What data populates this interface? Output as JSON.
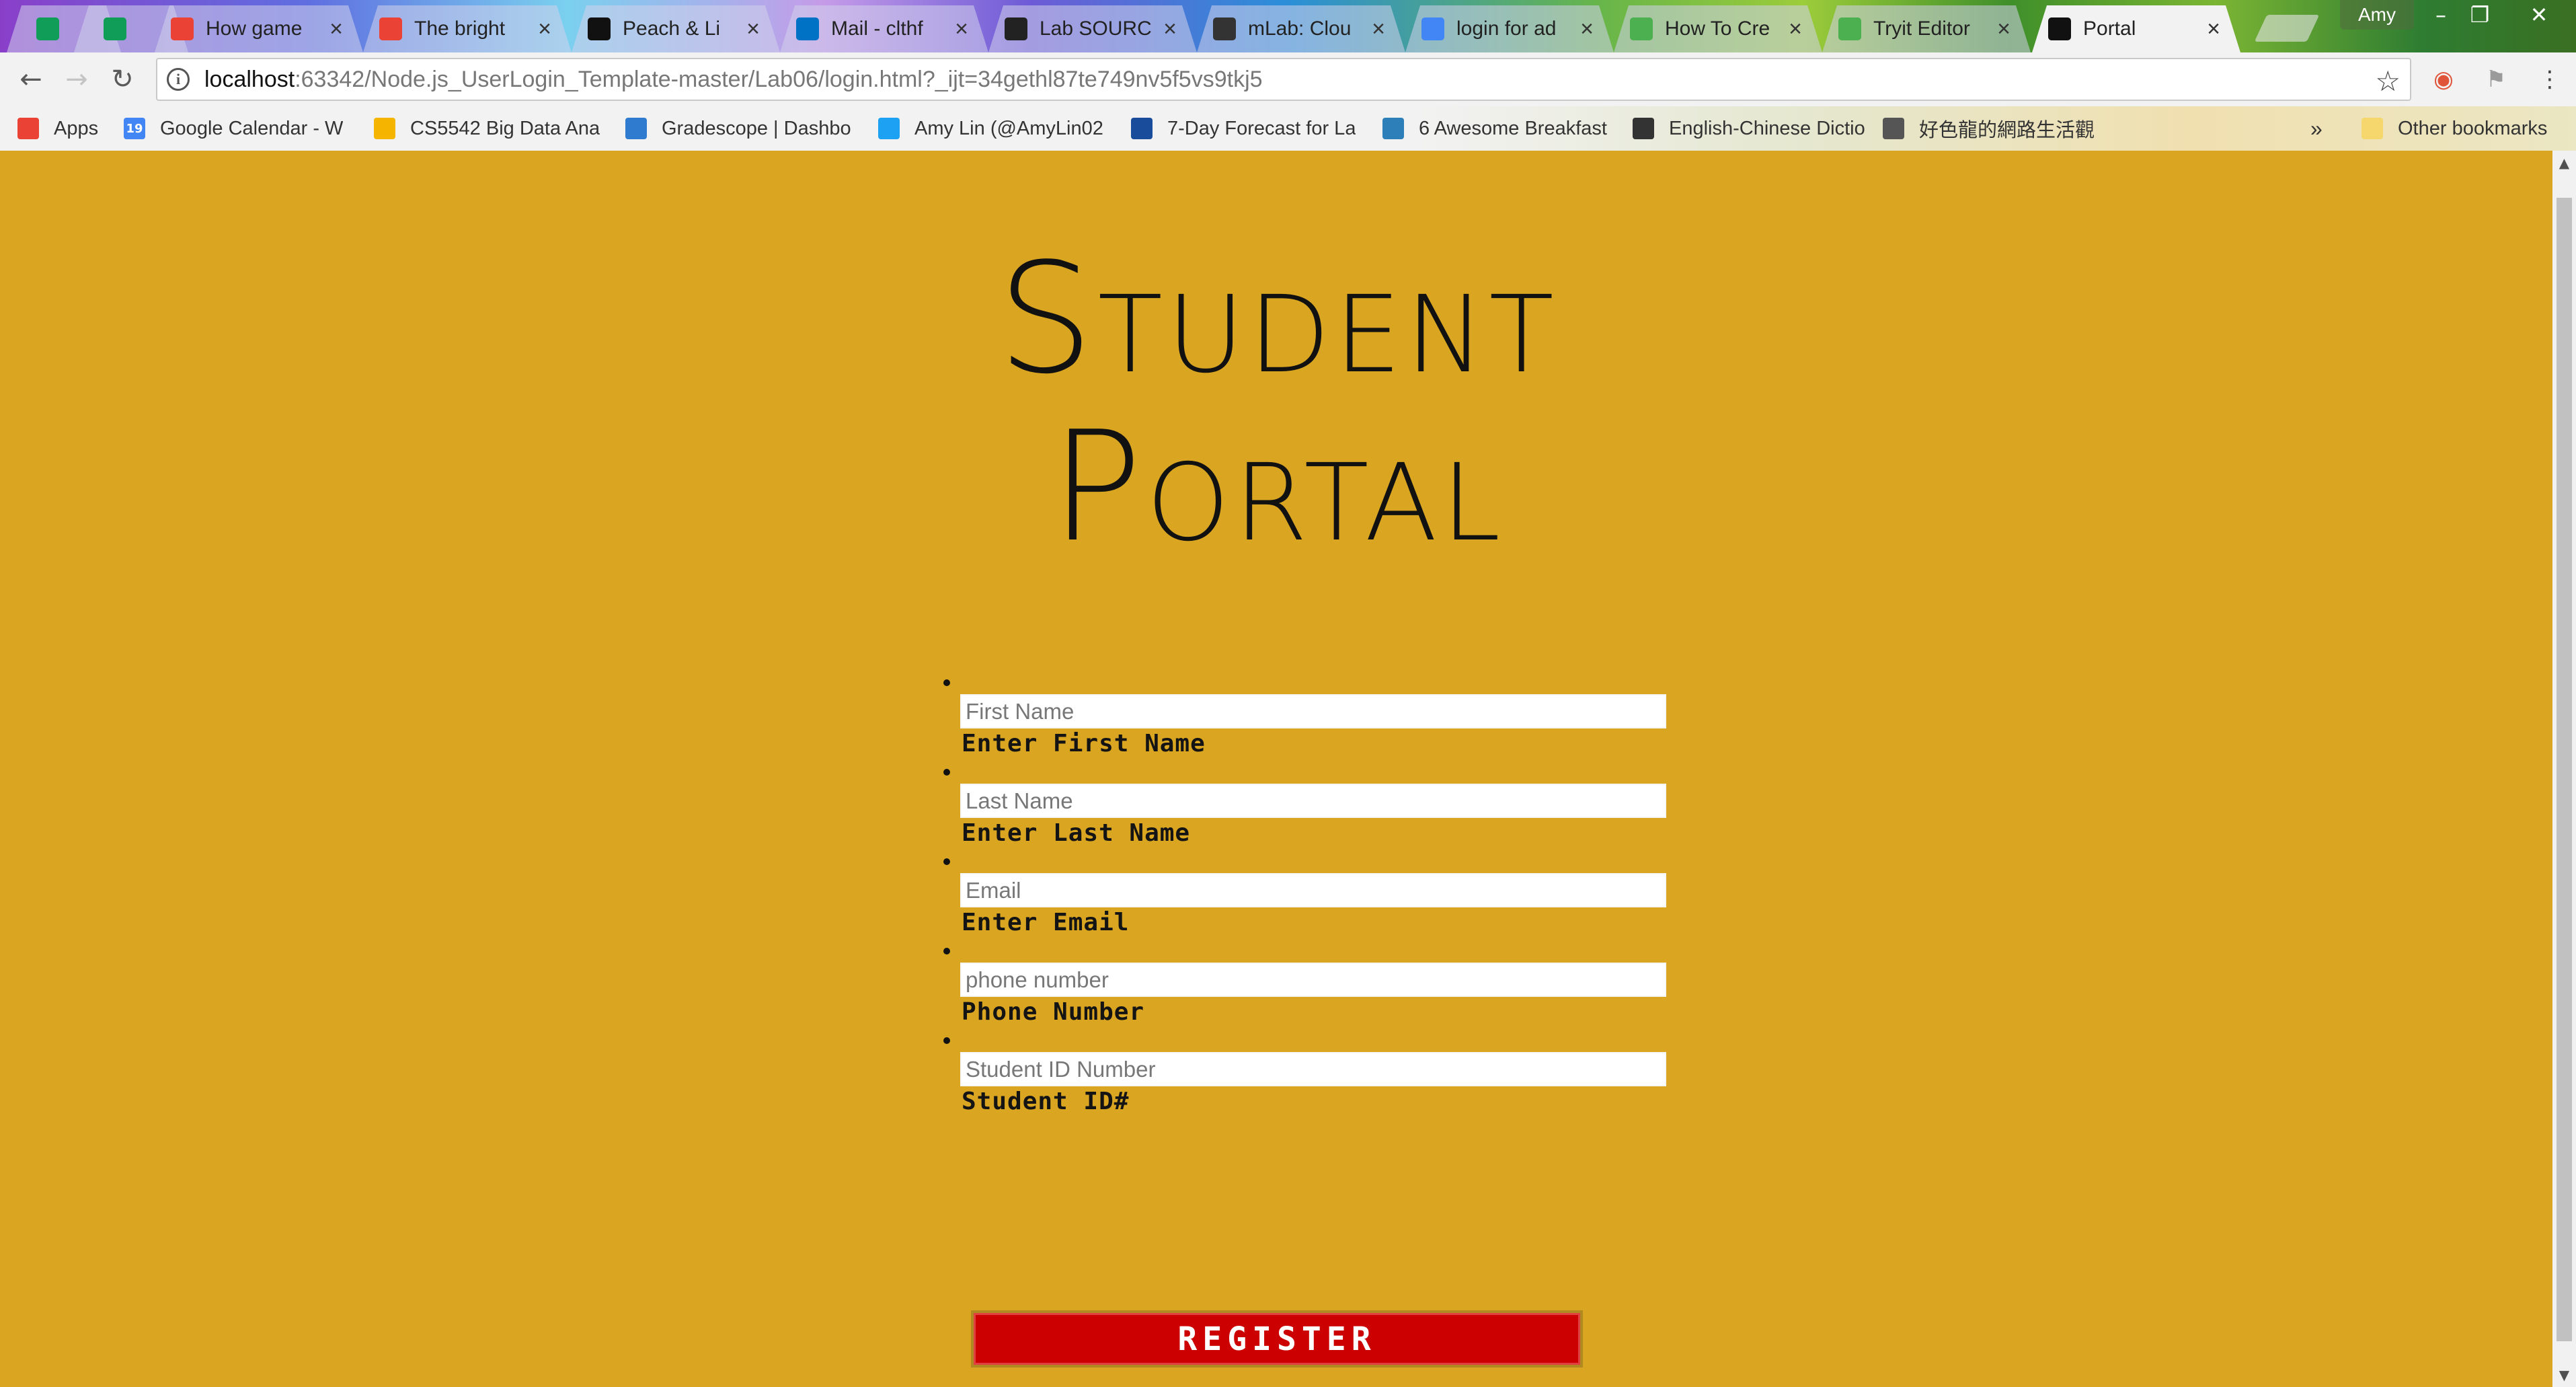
{
  "browser": {
    "tabs": [
      {
        "title": "",
        "icon": "sheets-icon",
        "color": "#0F9D58",
        "pinned": true
      },
      {
        "title": "",
        "icon": "sheets-icon",
        "color": "#0F9D58",
        "pinned": true
      },
      {
        "title": "How game",
        "icon": "gmail-icon",
        "color": "#EA4335"
      },
      {
        "title": "The bright",
        "icon": "gmail-icon",
        "color": "#EA4335"
      },
      {
        "title": "Peach & Li",
        "icon": "b-icon",
        "color": "#111111"
      },
      {
        "title": "Mail - clthf",
        "icon": "outlook-icon",
        "color": "#0072C6"
      },
      {
        "title": "Lab SOURC",
        "icon": "bb-icon",
        "color": "#222222"
      },
      {
        "title": "mLab: Clou",
        "icon": "mlab-icon",
        "color": "#333333"
      },
      {
        "title": "login for ad",
        "icon": "google-icon",
        "color": "#4285F4"
      },
      {
        "title": "How To Cre",
        "icon": "w3-icon",
        "color": "#4CAF50"
      },
      {
        "title": "Tryit Editor",
        "icon": "w3-icon",
        "color": "#4CAF50"
      },
      {
        "title": "Portal",
        "icon": "ws-icon",
        "color": "#111111",
        "active": true
      }
    ],
    "profile": "Amy",
    "window_buttons": {
      "minimize": "–",
      "restore": "❐",
      "close": "✕"
    },
    "address": {
      "host": "localhost",
      "path": ":63342/Node.js_UserLogin_Template-master/Lab06/login.html?_ijt=34gethl87te749nv5f5vs9tkj5"
    },
    "bookmarks": [
      {
        "label": "Apps",
        "icon": "apps-grid-icon",
        "color": "#EA4335"
      },
      {
        "label": "Google Calendar - W",
        "icon": "calendar-icon",
        "color": "#4285F4",
        "badge": "19"
      },
      {
        "label": "CS5542 Big Data Ana",
        "icon": "drive-icon",
        "color": "#F4B400"
      },
      {
        "label": "Gradescope | Dashbo",
        "icon": "chart-icon",
        "color": "#2E7BCF"
      },
      {
        "label": "Amy Lin (@AmyLin02",
        "icon": "twitter-icon",
        "color": "#1DA1F2"
      },
      {
        "label": "7-Day Forecast for La",
        "icon": "noaa-icon",
        "color": "#1a4c9c"
      },
      {
        "label": "6 Awesome Breakfast",
        "icon": "wiki-icon",
        "color": "#2c7fb8"
      },
      {
        "label": "English-Chinese Dictio",
        "icon": "dict-icon",
        "color": "#333333"
      },
      {
        "label": "好色龍的網路生活觀",
        "icon": "avatar-icon",
        "color": "#555555"
      }
    ],
    "bookmarks_more": "»",
    "other_bookmarks": "Other bookmarks"
  },
  "page": {
    "title_line1": "Student",
    "title_line2": "Portal",
    "fields": [
      {
        "placeholder": "First Name",
        "label": "Enter First Name"
      },
      {
        "placeholder": "Last Name",
        "label": "Enter Last Name"
      },
      {
        "placeholder": "Email",
        "label": "Enter Email"
      },
      {
        "placeholder": "phone number",
        "label": "Phone Number"
      },
      {
        "placeholder": "Student ID Number",
        "label": "Student ID#"
      }
    ],
    "register_label": "REGISTER",
    "background": "#DAA520",
    "button_color": "#CC0000"
  }
}
